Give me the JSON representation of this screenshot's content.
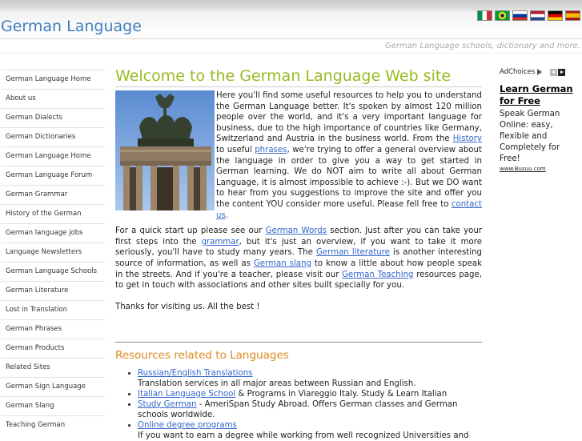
{
  "site": {
    "title": "German Language",
    "tagline": "German Language schools, dictionary and more."
  },
  "flags": [
    {
      "name": "italy-flag",
      "colors": [
        "#009246",
        "#ffffff",
        "#ce2b37"
      ],
      "layout": "vertical"
    },
    {
      "name": "brazil-flag",
      "colors": [
        "#009c3b",
        "#ffdf00",
        "#002776"
      ],
      "layout": "brazil"
    },
    {
      "name": "russia-flag",
      "colors": [
        "#ffffff",
        "#0039a6",
        "#d52b1e"
      ],
      "layout": "horizontal"
    },
    {
      "name": "netherlands-flag",
      "colors": [
        "#ae1c28",
        "#ffffff",
        "#21468b"
      ],
      "layout": "horizontal"
    },
    {
      "name": "germany-flag",
      "colors": [
        "#000000",
        "#dd0000",
        "#ffce00"
      ],
      "layout": "horizontal"
    },
    {
      "name": "spain-flag",
      "colors": [
        "#aa151b",
        "#f1bf00",
        "#aa151b"
      ],
      "layout": "spain"
    }
  ],
  "nav": {
    "items": [
      "German Language Home",
      "About us",
      "German Dialects",
      "German Dictionaries",
      "German Language Home",
      "German Language Forum",
      "German Grammar",
      "History of the German",
      "German language jobs",
      "Language Newsletters",
      "German Language Schools",
      "German Literature",
      "Lost in Translation",
      "German Phrases",
      "German Products",
      "Related Sites",
      "German Sign Language",
      "German Slang",
      "Teaching German"
    ]
  },
  "main": {
    "heading": "Welcome to the German Language Web site",
    "p1": {
      "a": "Here you'll find some useful resources to help you to understand the German Language better. It's spoken by almost 120 million people over the world, and it's a very important language for business, due to the high importance of countries like Germany, Switzerland and Austria in the business world. From the ",
      "link_history": "History",
      "b": " to useful ",
      "link_phrases": "phrases",
      "c": ", we're trying to offer a general overview about the language in order to give you a way to get started in German learning. We do NOT aim to write all about German Language, it is almost impossible to achieve :-). But we DO want to hear from you suggestions to improve the site and offer you the content YOU consider more useful. Please fell free to ",
      "link_contact": "contact us",
      "d": "."
    },
    "p2": {
      "a": "For a quick start up please see our ",
      "link_words": "German Words",
      "b": " section. Just after you can take your first steps into the ",
      "link_grammar": "grammar",
      "c": ", but it's just an overview, if you want to take it more seriously, you'll have to study many years. The ",
      "link_literature": "German literature",
      "d": " is another interesting source of information, as well as ",
      "link_slang": "German slang",
      "e": " to know a little about how people speak in the streets. And if you're a teacher, please visit our ",
      "link_teaching": "German Teaching",
      "f": " resources page, to get in touch with associations and other sites built specially for you."
    },
    "thanks": "Thanks for visiting us. All the best !"
  },
  "resources": {
    "heading": "Resources related to Languages",
    "items": [
      {
        "link": "Russian/English Translations",
        "after": "",
        "desc": "Translation services in all major areas between Russian and English."
      },
      {
        "link": "Italian Language School",
        "after": " & Programs in Viareggio Italy. Study & Learn Italian",
        "desc": ""
      },
      {
        "link": "Study German",
        "after": " - AmeriSpan Study Abroad. Offers German classes and German schools worldwide.",
        "desc": ""
      },
      {
        "link": "Online degree programs",
        "after": "",
        "desc": "If you want to earn a degree while working from well recognized Universities and"
      }
    ]
  },
  "ad": {
    "adchoices": "AdChoices",
    "title": "Learn German for Free",
    "body": "Speak German Online: easy, flexible and Completely for Free!",
    "url": "www.Busuu.com"
  }
}
